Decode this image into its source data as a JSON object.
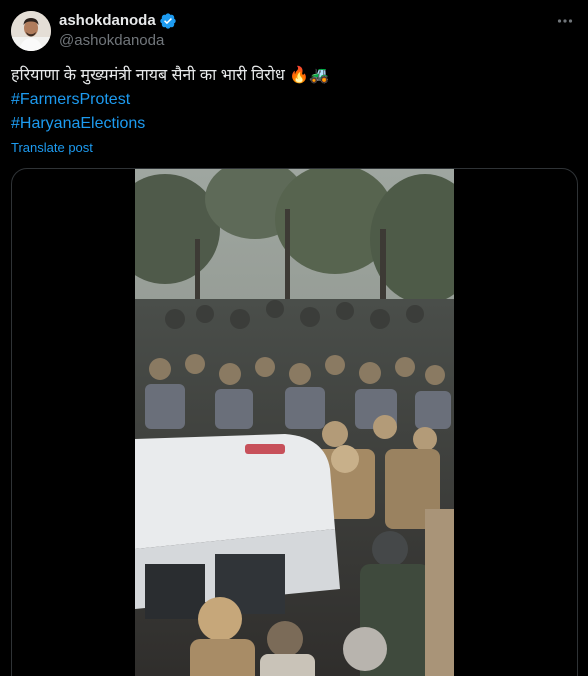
{
  "post": {
    "author": {
      "display_name": "ashokdanoda",
      "handle": "@ashokdanoda",
      "verified": true
    },
    "text_line": "हरियाणा के मुख्यमंत्री नायब सैनी का भारी विरोध",
    "emojis": "🔥🚜",
    "hashtags": [
      "#FarmersProtest",
      "#HaryanaElections"
    ],
    "translate_label": "Translate post",
    "media_type": "video"
  },
  "icons": {
    "verified": "verified-badge-icon",
    "more": "more-options-icon"
  },
  "colors": {
    "background": "#000000",
    "text": "#e7e9ea",
    "secondary": "#71767b",
    "accent": "#1d9bf0",
    "border": "#2f3336"
  }
}
